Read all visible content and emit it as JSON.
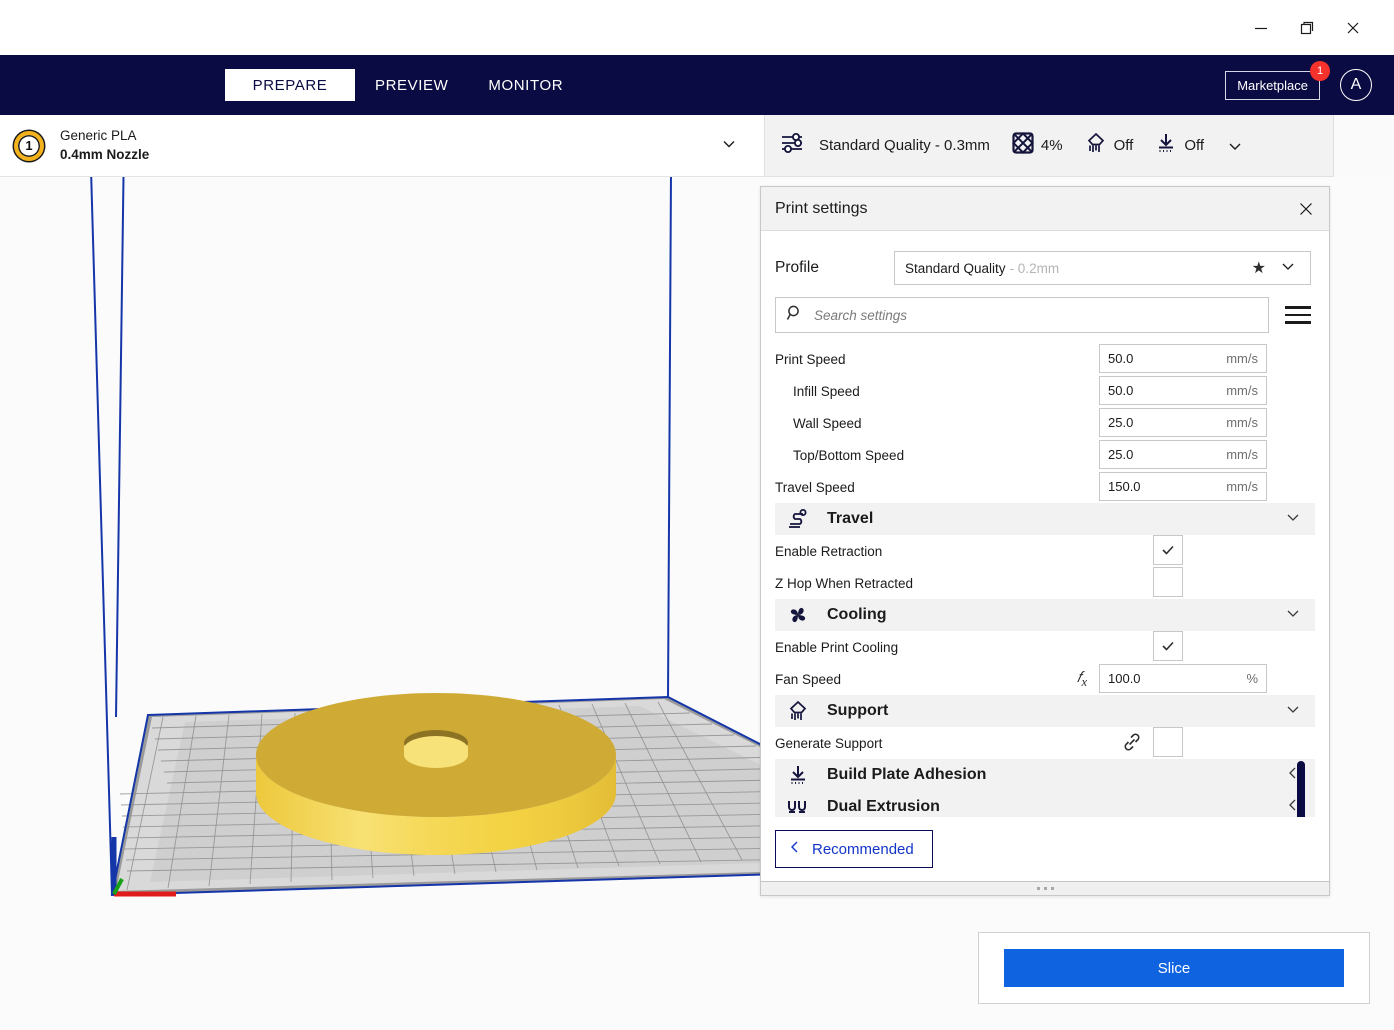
{
  "window": {
    "minimize_label": "minimize",
    "maximize_label": "restore",
    "close_label": "close"
  },
  "nav": {
    "stages": [
      {
        "label": "PREPARE",
        "active": true
      },
      {
        "label": "PREVIEW",
        "active": false
      },
      {
        "label": "MONITOR",
        "active": false
      }
    ],
    "marketplace_label": "Marketplace",
    "marketplace_badge": "1",
    "avatar_initial": "A"
  },
  "config_bar": {
    "extruder_number": "1",
    "material_name": "Generic PLA",
    "nozzle": "0.4mm Nozzle",
    "print_setup": {
      "profile_label": "Standard Quality - 0.3mm",
      "infill_value": "4%",
      "support_value": "Off",
      "adhesion_value": "Off"
    }
  },
  "print_settings": {
    "title": "Print settings",
    "profile_label": "Profile",
    "profile_name": "Standard Quality",
    "profile_size": "- 0.2mm",
    "search_placeholder": "Search settings",
    "search_value": "",
    "rows": [
      {
        "kind": "setting",
        "label": "Print Speed",
        "indent": 0,
        "value": "50.0",
        "unit": "mm/s"
      },
      {
        "kind": "setting",
        "label": "Infill Speed",
        "indent": 1,
        "value": "50.0",
        "unit": "mm/s"
      },
      {
        "kind": "setting",
        "label": "Wall Speed",
        "indent": 1,
        "value": "25.0",
        "unit": "mm/s"
      },
      {
        "kind": "setting",
        "label": "Top/Bottom Speed",
        "indent": 1,
        "value": "25.0",
        "unit": "mm/s"
      },
      {
        "kind": "setting",
        "label": "Travel Speed",
        "indent": 0,
        "value": "150.0",
        "unit": "mm/s"
      },
      {
        "kind": "category",
        "label": "Travel",
        "icon": "travel-icon",
        "expanded": true
      },
      {
        "kind": "checkbox",
        "label": "Enable Retraction",
        "indent": 0,
        "checked": true
      },
      {
        "kind": "checkbox",
        "label": "Z Hop When Retracted",
        "indent": 0,
        "checked": false
      },
      {
        "kind": "category",
        "label": "Cooling",
        "icon": "fan-icon",
        "expanded": true
      },
      {
        "kind": "checkbox",
        "label": "Enable Print Cooling",
        "indent": 0,
        "checked": true
      },
      {
        "kind": "setting",
        "label": "Fan Speed",
        "indent": 0,
        "value": "100.0",
        "unit": "%",
        "fx": true
      },
      {
        "kind": "category",
        "label": "Support",
        "icon": "support-icon",
        "expanded": true
      },
      {
        "kind": "checkbox",
        "label": "Generate Support",
        "indent": 0,
        "checked": false,
        "linked": true
      },
      {
        "kind": "category",
        "label": "Build Plate Adhesion",
        "icon": "adhesion-icon",
        "expanded": false
      },
      {
        "kind": "category",
        "label": "Dual Extrusion",
        "icon": "dual-extrusion-icon",
        "expanded": false
      }
    ],
    "recommended_label": "Recommended"
  },
  "action": {
    "slice_label": "Slice"
  },
  "colors": {
    "nav_background": "#0b0b43",
    "accent_blue": "#1063e0",
    "badge_red": "#f5322c",
    "extruder_yellow": "#f3b21b",
    "model_yellow": "#f4d03f",
    "scrollbar": "#0b0b43"
  },
  "viewport": {
    "model_name": "washer-disc-model",
    "build_plate_name": "build-plate-grid"
  }
}
